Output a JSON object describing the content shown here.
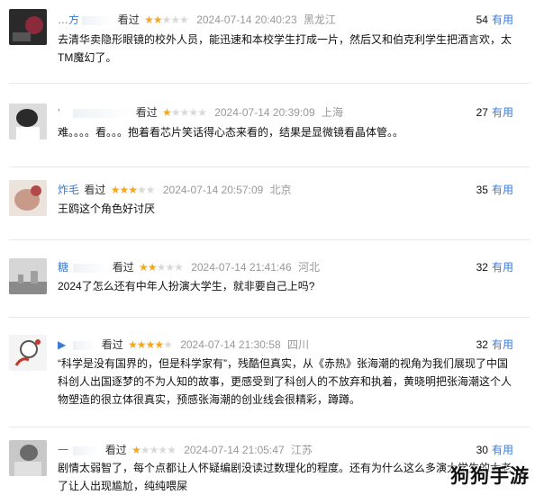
{
  "reviews": [
    {
      "user": "…方",
      "watched": "看过",
      "rating": 2,
      "time": "2024-07-14 20:40:23",
      "location": "黑龙江",
      "votes": "54",
      "useful": "有用",
      "text": "去清华卖隐形眼镜的校外人员，能迅速和本校学生打成一片，然后又和伯克利学生把酒言欢，太TM魔幻了。",
      "avatar_color": "#3a3a3a"
    },
    {
      "user": "‘",
      "watched": "看过",
      "rating": 1,
      "time": "2024-07-14 20:39:09",
      "location": "上海",
      "votes": "27",
      "useful": "有用",
      "text": "难。。。。看。。。抱着看芯片笑话得心态来看的，结果是显微镜看晶体管。。",
      "avatar_color": "#5a5a5a"
    },
    {
      "user": "炸毛",
      "watched": "看过",
      "rating": 3,
      "time": "2024-07-14 20:57:09",
      "location": "北京",
      "votes": "35",
      "useful": "有用",
      "text": "王鸥这个角色好讨厌",
      "avatar_color": "#c9b8a8"
    },
    {
      "user": "糖",
      "watched": "看过",
      "rating": 2,
      "time": "2024-07-14 21:41:46",
      "location": "河北",
      "votes": "32",
      "useful": "有用",
      "text": "2024了怎么还有中年人扮演大学生，就非要自己上吗?",
      "avatar_color": "#cccccc"
    },
    {
      "user": "▶",
      "watched": "看过",
      "rating": 4,
      "time": "2024-07-14 21:30:58",
      "location": "四川",
      "votes": "32",
      "useful": "有用",
      "text": "“科学是没有国界的，但是科学家有”，残酷但真实，从《赤热》张海潮的视角为我们展现了中国科创人出国逐梦的不为人知的故事，更感受到了科创人的不放弃和执着，黄晓明把张海潮这个人物塑造的很立体很真实，预感张海潮的创业线会很精彩，蹲蹲。",
      "avatar_color": "#e8e8e8"
    },
    {
      "user": "一",
      "watched": "看过",
      "rating": 1,
      "time": "2024-07-14 21:05:47",
      "location": "江苏",
      "votes": "30",
      "useful": "有用",
      "text": "剧情太弱智了，每个点都让人怀疑编剧没读过数理化的程度。还有为什么这么多演大学生的太老了让人出现尴尬，纯纯喂屎",
      "avatar_color": "#b0b0b0"
    }
  ],
  "watermark": "狗狗手游"
}
